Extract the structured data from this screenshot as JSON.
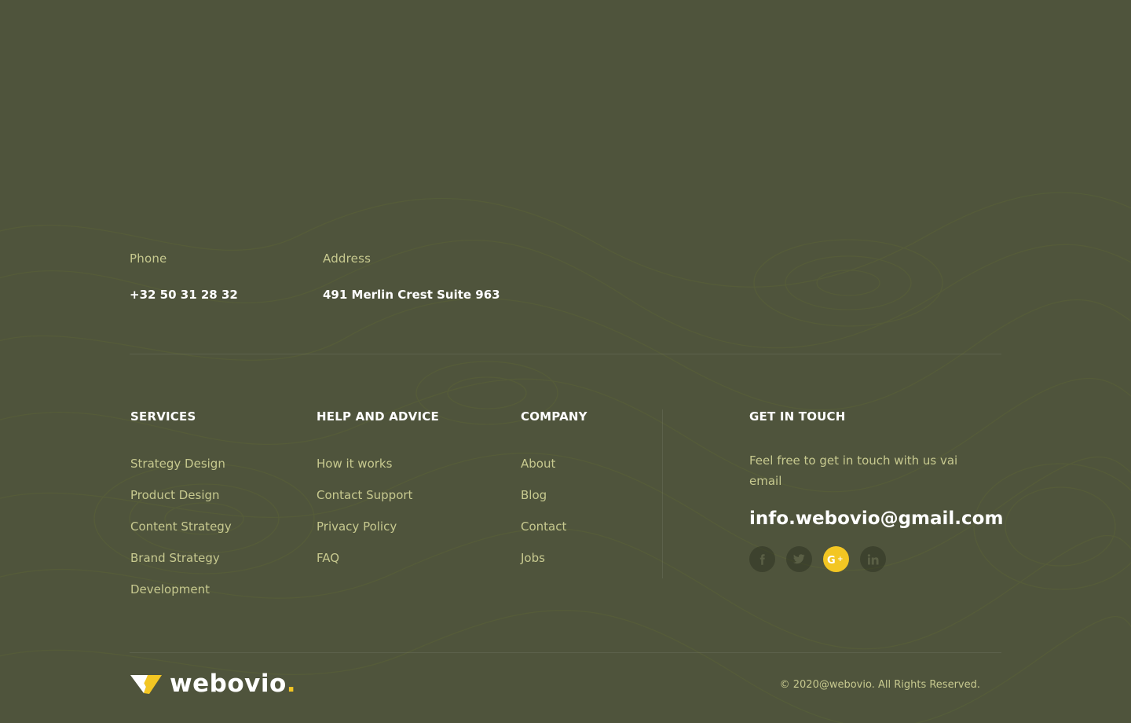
{
  "contact": {
    "phone_label": "Phone",
    "phone_value": "+32 50 31 28 32",
    "address_label": "Address",
    "address_value": "491 Merlin Crest Suite 963"
  },
  "services": {
    "title": "SERVICES",
    "items": [
      "Strategy Design",
      "Product Design",
      "Content Strategy",
      "Brand Strategy",
      "Development"
    ]
  },
  "help": {
    "title": "HELP AND ADVICE",
    "items": [
      "How it works",
      "Contact Support",
      "Privacy Policy",
      "FAQ"
    ]
  },
  "company": {
    "title": "COMPANY",
    "items": [
      "About",
      "Blog",
      "Contact",
      "Jobs"
    ]
  },
  "get_in_touch": {
    "title": "GET IN TOUCH",
    "text": "Feel free to get in touch with us vai email",
    "email": "info.webovio@gmail.com",
    "socials": [
      {
        "icon": "facebook-icon",
        "active": false
      },
      {
        "icon": "twitter-icon",
        "active": false
      },
      {
        "icon": "google-plus-icon",
        "active": true
      },
      {
        "icon": "linkedin-icon",
        "active": false
      }
    ]
  },
  "brand": {
    "name": "webovio",
    "dot": "."
  },
  "copyright": "© 2020@webovio. All Rights Reserved.",
  "colors": {
    "background": "#4f543c",
    "accent": "#f3c623",
    "text_muted": "#c7c98f",
    "text_white": "#ffffff"
  }
}
